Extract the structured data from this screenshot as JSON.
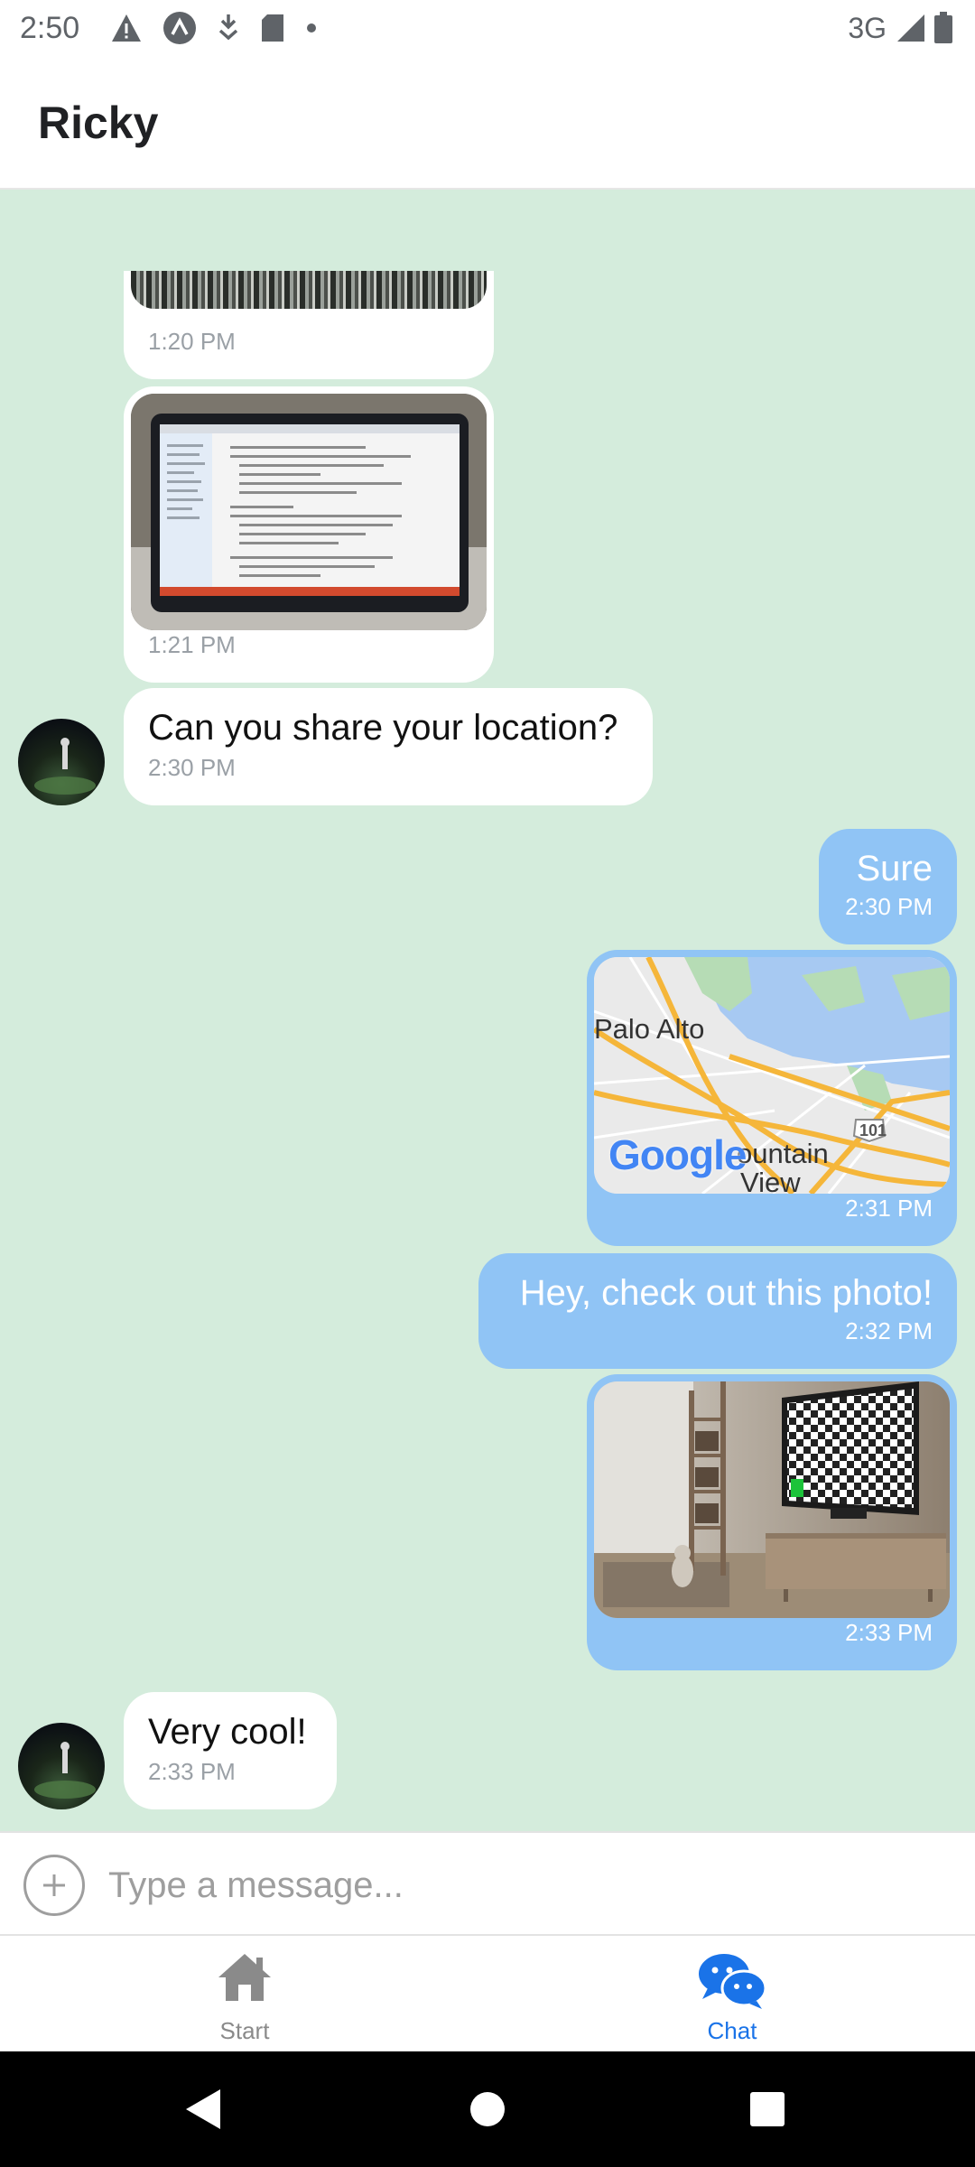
{
  "status_bar": {
    "time": "2:50",
    "network": "3G",
    "icons": [
      "warning-icon",
      "app-a-icon",
      "download-icon",
      "sd-card-icon",
      "dot-icon",
      "signal-icon",
      "battery-icon"
    ]
  },
  "header": {
    "title": "Ricky"
  },
  "messages": [
    {
      "direction": "in",
      "type": "image",
      "image": "photo-partial",
      "time": "1:20 PM"
    },
    {
      "direction": "in",
      "type": "image",
      "image": "laptop-photo",
      "time": "1:21 PM"
    },
    {
      "direction": "in",
      "type": "text",
      "text": "Can you share your location?",
      "time": "2:30 PM"
    },
    {
      "direction": "out",
      "type": "text",
      "text": "Sure",
      "time": "2:30 PM"
    },
    {
      "direction": "out",
      "type": "map",
      "time": "2:31 PM",
      "map": {
        "label_city1": "Palo Alto",
        "label_city2_line1": "ountain",
        "label_city2_line2": "View",
        "highway": "101",
        "logo": "Google"
      }
    },
    {
      "direction": "out",
      "type": "text",
      "text": "Hey, check out this photo!",
      "time": "2:32 PM"
    },
    {
      "direction": "out",
      "type": "image",
      "image": "room-tv-photo",
      "time": "2:33 PM"
    },
    {
      "direction": "in",
      "type": "text",
      "text": "Very cool!",
      "time": "2:33 PM"
    }
  ],
  "composer": {
    "placeholder": "Type a message..."
  },
  "tabs": [
    {
      "label": "Start",
      "icon": "home-icon",
      "active": false
    },
    {
      "label": "Chat",
      "icon": "chat-icon",
      "active": true
    }
  ],
  "colors": {
    "chat_background": "#d4ecdc",
    "incoming_bubble": "#ffffff",
    "outgoing_bubble": "#90c4f5",
    "active_tab": "#1a73e8",
    "inactive_tab": "#8a8a8a"
  }
}
